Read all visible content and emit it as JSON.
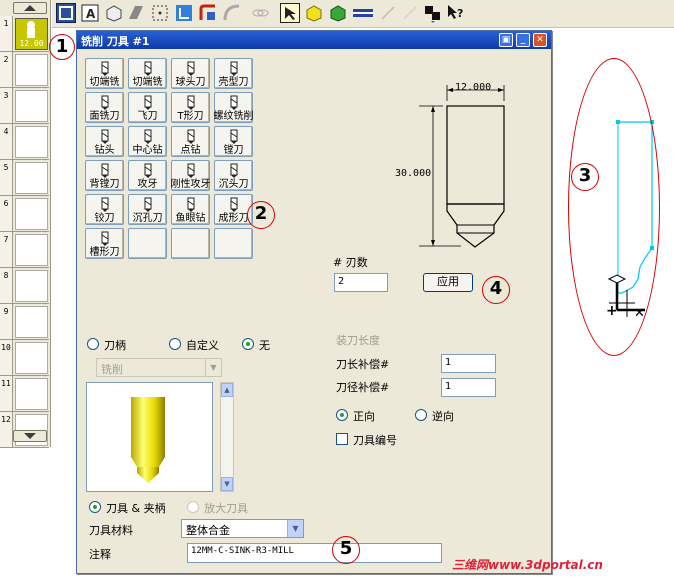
{
  "toolbar": {
    "icons": [
      "select-frame-icon",
      "text-icon",
      "box-icon",
      "shape-icon",
      "dotted-frame-icon",
      "move-icon",
      "fillet-icon",
      "curve-icon",
      "chain-icon",
      "cursor-icon",
      "cube-yellow-icon",
      "cube-green-icon",
      "stripe-icon",
      "arrow-icon",
      "view-icon",
      "help-icon"
    ]
  },
  "palette": {
    "slots": [
      {
        "num": "1",
        "value": "12.00"
      },
      {
        "num": "2",
        "value": ""
      },
      {
        "num": "3",
        "value": ""
      },
      {
        "num": "4",
        "value": ""
      },
      {
        "num": "5",
        "value": ""
      },
      {
        "num": "6",
        "value": ""
      },
      {
        "num": "7",
        "value": ""
      },
      {
        "num": "8",
        "value": ""
      },
      {
        "num": "9",
        "value": ""
      },
      {
        "num": "10",
        "value": ""
      },
      {
        "num": "11",
        "value": ""
      },
      {
        "num": "12",
        "value": ""
      }
    ]
  },
  "dialog": {
    "title": "铣削 刀具 #1",
    "tools": [
      "切端铣",
      "切端铣",
      "球头刀",
      "壳型刀",
      "面铣刀",
      "飞刀",
      "T形刀",
      "螺纹铣削",
      "钻头",
      "中心钻",
      "点钻",
      "镗刀",
      "背镗刀",
      "攻牙",
      "刚性攻牙",
      "沉头刀",
      "铰刀",
      "沉孔刀",
      "鱼眼钻",
      "成形刀",
      "槽形刀",
      "",
      "",
      ""
    ],
    "preview": {
      "width": "12.000",
      "length": "30.000"
    },
    "flutes_label": "# 刃数",
    "flutes_value": "2",
    "apply_label": "应用",
    "holder_options": [
      "刀柄",
      "自定义",
      "无"
    ],
    "holder_select": "铣削",
    "length_offset_title": "装刀长度",
    "length_comp_label": "刀长补偿#",
    "length_comp_value": "1",
    "radius_comp_label": "刀径补偿#",
    "radius_comp_value": "1",
    "direction_forward": "正向",
    "direction_reverse": "逆向",
    "tool_number_label": "刀具编号",
    "view_tool_holder": "刀具 & 夹柄",
    "view_zoom": "放大刀具",
    "material_label": "刀具材料",
    "material_value": "整体合金",
    "comment_label": "注释",
    "comment_value": "12MM-C-SINK-R3-MILL"
  },
  "callouts": [
    "1",
    "2",
    "3",
    "4",
    "5"
  ],
  "watermark": "三维网www.3dportal.cn"
}
